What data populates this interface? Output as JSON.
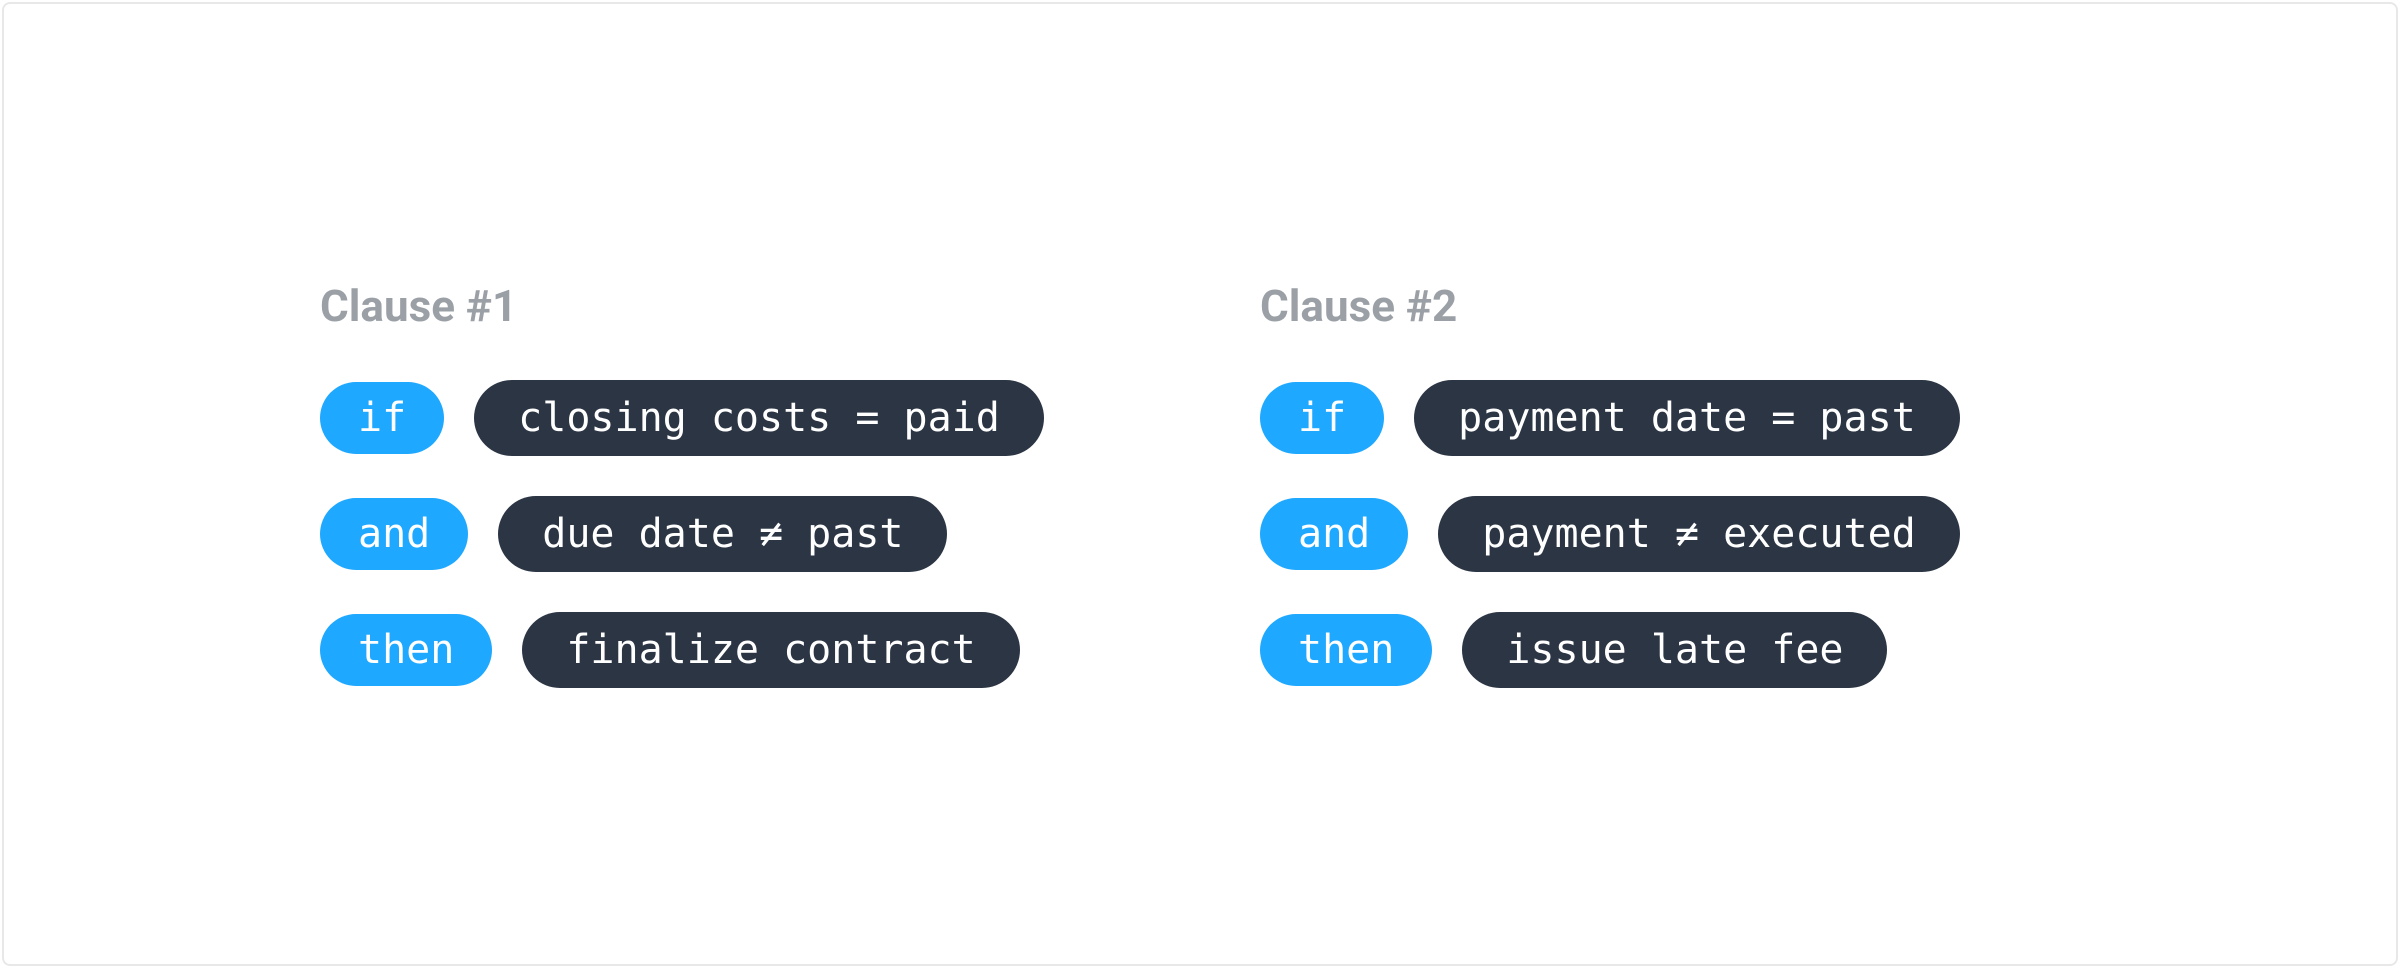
{
  "clauses": [
    {
      "title": "Clause #1",
      "rows": [
        {
          "keyword": "if",
          "expression": "closing costs = paid"
        },
        {
          "keyword": "and",
          "expression": "due date ≠ past"
        },
        {
          "keyword": "then",
          "expression": "finalize contract"
        }
      ]
    },
    {
      "title": "Clause #2",
      "rows": [
        {
          "keyword": "if",
          "expression": "payment date = past"
        },
        {
          "keyword": "and",
          "expression": "payment ≠ executed"
        },
        {
          "keyword": "then",
          "expression": "issue late fee"
        }
      ]
    }
  ],
  "colors": {
    "keyword_bg": "#1ea8ff",
    "expression_bg": "#2b3544",
    "title_color": "#9aa0a6"
  }
}
